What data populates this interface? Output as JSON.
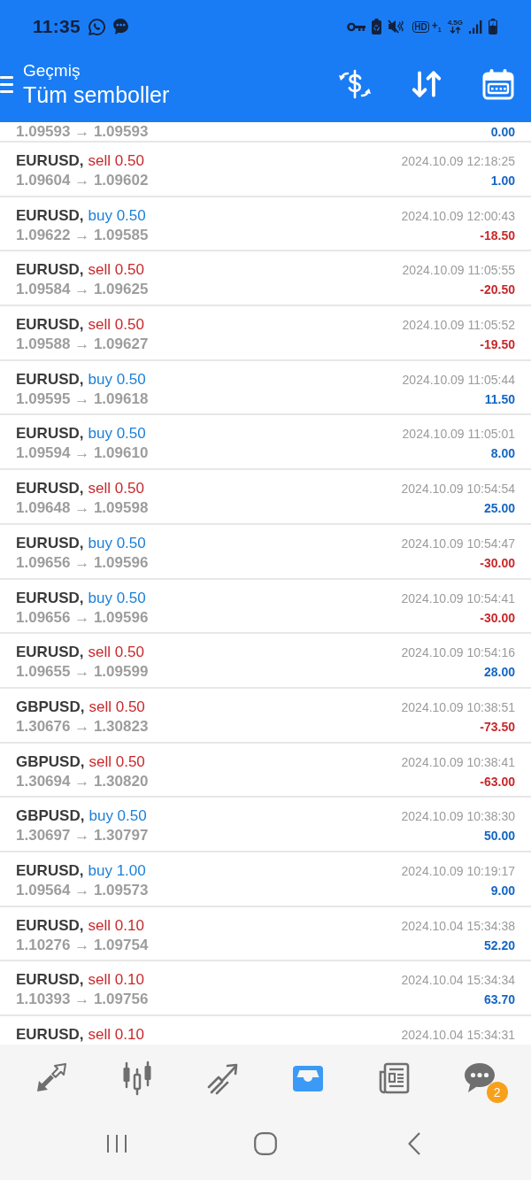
{
  "status_bar": {
    "time": "11:35",
    "hd": "HD",
    "hd_suffix": "+$_{1}$",
    "network": "4.5G"
  },
  "header": {
    "screen": "Geçmiş",
    "filter": "Tüm semboller"
  },
  "deals": [
    {
      "prices": "1.09593 → 1.09593",
      "profit": "0.00",
      "loss": false
    },
    {
      "symbol": "EURUSD,",
      "order": "sell 0.50",
      "kind": "sell",
      "time": "2024.10.09 12:18:25",
      "prices": "1.09604 → 1.09602",
      "profit": "1.00",
      "loss": false
    },
    {
      "symbol": "EURUSD,",
      "order": "buy 0.50",
      "kind": "buy",
      "time": "2024.10.09 12:00:43",
      "prices": "1.09622 → 1.09585",
      "profit": "-18.50",
      "loss": true
    },
    {
      "symbol": "EURUSD,",
      "order": "sell 0.50",
      "kind": "sell",
      "time": "2024.10.09 11:05:55",
      "prices": "1.09584 → 1.09625",
      "profit": "-20.50",
      "loss": true
    },
    {
      "symbol": "EURUSD,",
      "order": "sell 0.50",
      "kind": "sell",
      "time": "2024.10.09 11:05:52",
      "prices": "1.09588 → 1.09627",
      "profit": "-19.50",
      "loss": true
    },
    {
      "symbol": "EURUSD,",
      "order": "buy 0.50",
      "kind": "buy",
      "time": "2024.10.09 11:05:44",
      "prices": "1.09595 → 1.09618",
      "profit": "11.50",
      "loss": false
    },
    {
      "symbol": "EURUSD,",
      "order": "buy 0.50",
      "kind": "buy",
      "time": "2024.10.09 11:05:01",
      "prices": "1.09594 → 1.09610",
      "profit": "8.00",
      "loss": false
    },
    {
      "symbol": "EURUSD,",
      "order": "sell 0.50",
      "kind": "sell",
      "time": "2024.10.09 10:54:54",
      "prices": "1.09648 → 1.09598",
      "profit": "25.00",
      "loss": false
    },
    {
      "symbol": "EURUSD,",
      "order": "buy 0.50",
      "kind": "buy",
      "time": "2024.10.09 10:54:47",
      "prices": "1.09656 → 1.09596",
      "profit": "-30.00",
      "loss": true
    },
    {
      "symbol": "EURUSD,",
      "order": "buy 0.50",
      "kind": "buy",
      "time": "2024.10.09 10:54:41",
      "prices": "1.09656 → 1.09596",
      "profit": "-30.00",
      "loss": true
    },
    {
      "symbol": "EURUSD,",
      "order": "sell 0.50",
      "kind": "sell",
      "time": "2024.10.09 10:54:16",
      "prices": "1.09655 → 1.09599",
      "profit": "28.00",
      "loss": false
    },
    {
      "symbol": "GBPUSD,",
      "order": "sell 0.50",
      "kind": "sell",
      "time": "2024.10.09 10:38:51",
      "prices": "1.30676 → 1.30823",
      "profit": "-73.50",
      "loss": true
    },
    {
      "symbol": "GBPUSD,",
      "order": "sell 0.50",
      "kind": "sell",
      "time": "2024.10.09 10:38:41",
      "prices": "1.30694 → 1.30820",
      "profit": "-63.00",
      "loss": true
    },
    {
      "symbol": "GBPUSD,",
      "order": "buy 0.50",
      "kind": "buy",
      "time": "2024.10.09 10:38:30",
      "prices": "1.30697 → 1.30797",
      "profit": "50.00",
      "loss": false
    },
    {
      "symbol": "EURUSD,",
      "order": "buy 1.00",
      "kind": "buy",
      "time": "2024.10.09 10:19:17",
      "prices": "1.09564 → 1.09573",
      "profit": "9.00",
      "loss": false
    },
    {
      "symbol": "EURUSD,",
      "order": "sell 0.10",
      "kind": "sell",
      "time": "2024.10.04 15:34:38",
      "prices": "1.10276 → 1.09754",
      "profit": "52.20",
      "loss": false
    },
    {
      "symbol": "EURUSD,",
      "order": "sell 0.10",
      "kind": "sell",
      "time": "2024.10.04 15:34:34",
      "prices": "1.10393 → 1.09756",
      "profit": "63.70",
      "loss": false
    },
    {
      "symbol": "EURUSD,",
      "order": "sell 0.10",
      "kind": "sell",
      "time": "2024.10.04 15:34:31"
    }
  ],
  "nav": {
    "tabs": [
      {
        "kind": "quotes",
        "selected": false
      },
      {
        "kind": "chart",
        "selected": false
      },
      {
        "kind": "trade",
        "selected": false
      },
      {
        "kind": "history",
        "selected": true
      },
      {
        "kind": "news",
        "selected": false
      },
      {
        "kind": "chat",
        "selected": false,
        "badge": "2"
      }
    ]
  }
}
